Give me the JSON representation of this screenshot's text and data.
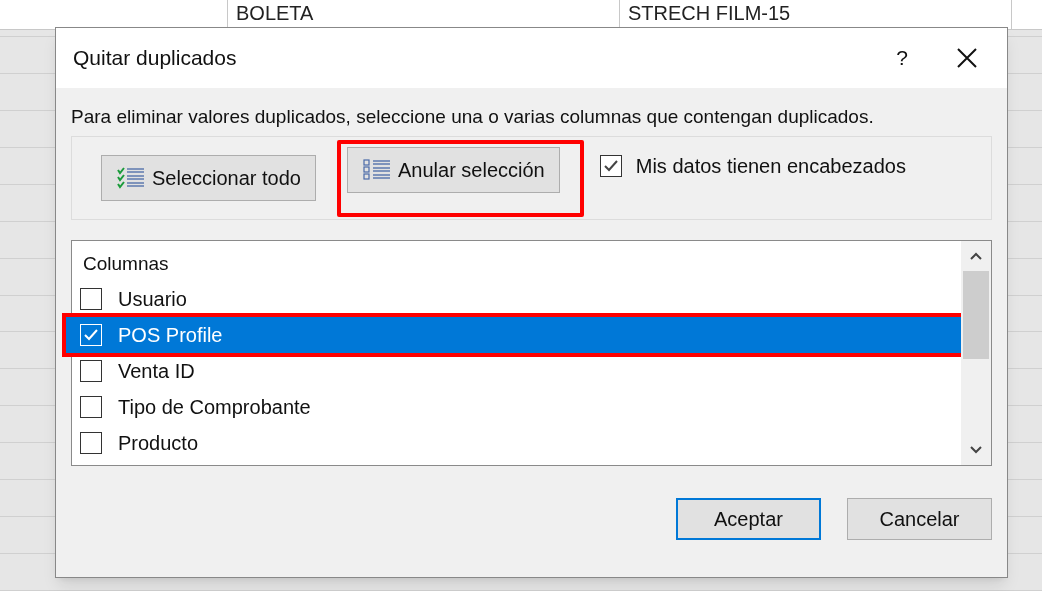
{
  "sheet": {
    "cells": [
      "BOLETA",
      "STRECH FILM-15"
    ]
  },
  "dialog": {
    "title": "Quitar duplicados",
    "help": "?",
    "instruction": "Para eliminar valores duplicados, seleccione una o varias columnas que contengan duplicados.",
    "buttons": [
      {
        "kind": "select-all",
        "label": "Seleccionar todo",
        "highlighted": false
      },
      {
        "kind": "unselect-all",
        "label": "Anular selección",
        "highlighted": true
      }
    ],
    "headers_checkbox": {
      "label": "Mis datos tienen encabezados",
      "checked": true
    },
    "list": {
      "header": "Columnas",
      "items": [
        {
          "label": "Usuario",
          "checked": false,
          "selected": false
        },
        {
          "label": "POS Profile",
          "checked": true,
          "selected": true
        },
        {
          "label": "Venta ID",
          "checked": false,
          "selected": false
        },
        {
          "label": "Tipo de Comprobante",
          "checked": false,
          "selected": false
        },
        {
          "label": "Producto",
          "checked": false,
          "selected": false
        }
      ]
    },
    "actions": [
      {
        "label": "Aceptar",
        "default": true
      },
      {
        "label": "Cancelar",
        "default": false
      }
    ]
  }
}
